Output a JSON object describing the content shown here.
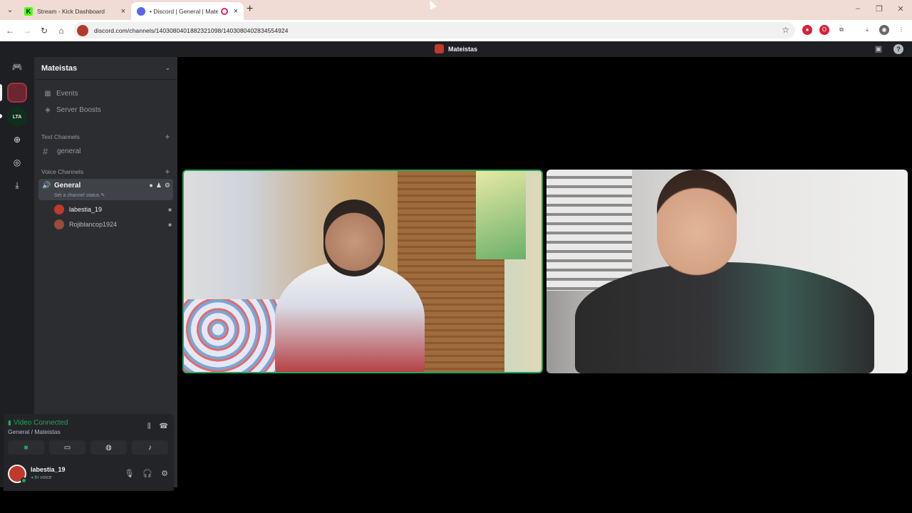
{
  "browser": {
    "tabs": [
      {
        "title": "Stream - Kick Dashboard",
        "active": false,
        "favicon_color": "#53fc18"
      },
      {
        "title": "• Discord | General | Mateis",
        "active": true,
        "favicon_color": "#5865f2"
      }
    ],
    "url": "discord.com/channels/1403080401882321098/1403080402834554924",
    "icons": {
      "new_tab": "+",
      "close": "×",
      "back": "←",
      "forward": "→",
      "reload": "↻",
      "home": "⌂",
      "star": "☆"
    }
  },
  "discord": {
    "window_title": "Mateistas",
    "server": {
      "name": "Mateistas"
    },
    "nav": {
      "events": "Events",
      "boosts": "Server Boosts"
    },
    "categories": {
      "text": "Text Channels",
      "voice": "Voice Channels"
    },
    "text_channels": [
      {
        "name": "general"
      }
    ],
    "voice_channel": {
      "name": "General",
      "status_placeholder": "Set a channel status",
      "members": [
        {
          "name": "labestia_19",
          "color": "#c0392b"
        },
        {
          "name": "Rojiblancop1924",
          "color": "#9b4b3a"
        }
      ]
    },
    "voice_panel": {
      "status": "Video Connected",
      "channel": "General / Mateistas"
    },
    "user": {
      "name": "labestia_19",
      "sub": "In voice"
    },
    "accent_green": "#23a55a",
    "guild_lta_label": "LTA"
  }
}
